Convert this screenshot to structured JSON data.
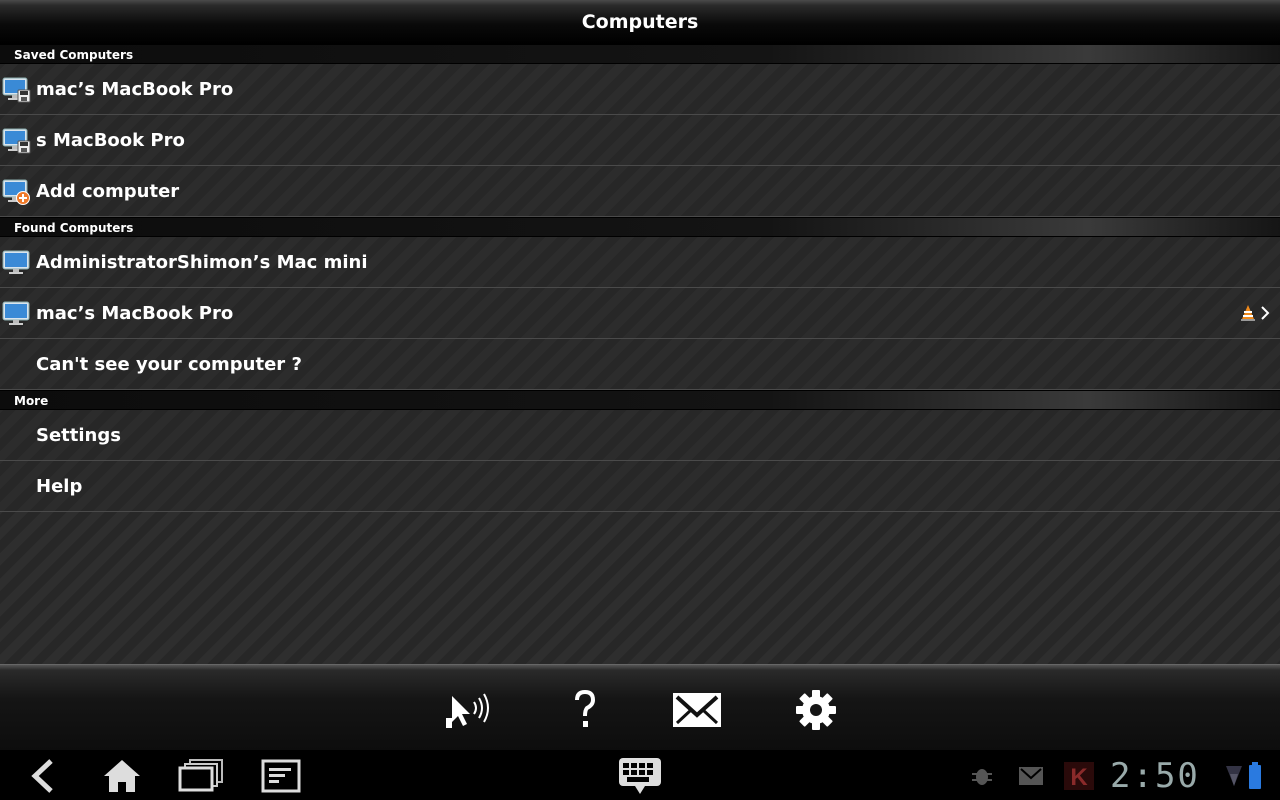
{
  "title": "Computers",
  "sections": {
    "saved": {
      "header": "Saved Computers",
      "items": [
        {
          "label": "mac’s MacBook Pro"
        },
        {
          "label": "s MacBook Pro"
        },
        {
          "label": "Add computer"
        }
      ]
    },
    "found": {
      "header": "Found Computers",
      "items": [
        {
          "label": "AdministratorShimon’s Mac mini"
        },
        {
          "label": "mac’s MacBook Pro"
        },
        {
          "label": "Can't see your computer ?"
        }
      ]
    },
    "more": {
      "header": "More",
      "items": [
        {
          "label": "Settings"
        },
        {
          "label": "Help"
        }
      ]
    }
  },
  "toolbar": {
    "buttons": [
      "remote-signal-icon",
      "help-icon",
      "mail-icon",
      "gear-icon"
    ]
  },
  "status_bar": {
    "time": "2:50",
    "icons": [
      "debug-icon",
      "gmail-icon",
      "k-app-icon",
      "wifi-icon",
      "battery-icon"
    ]
  },
  "colors": {
    "background": "#2b2b2b",
    "text": "#ffffff",
    "clock": "#9aa9aa"
  }
}
